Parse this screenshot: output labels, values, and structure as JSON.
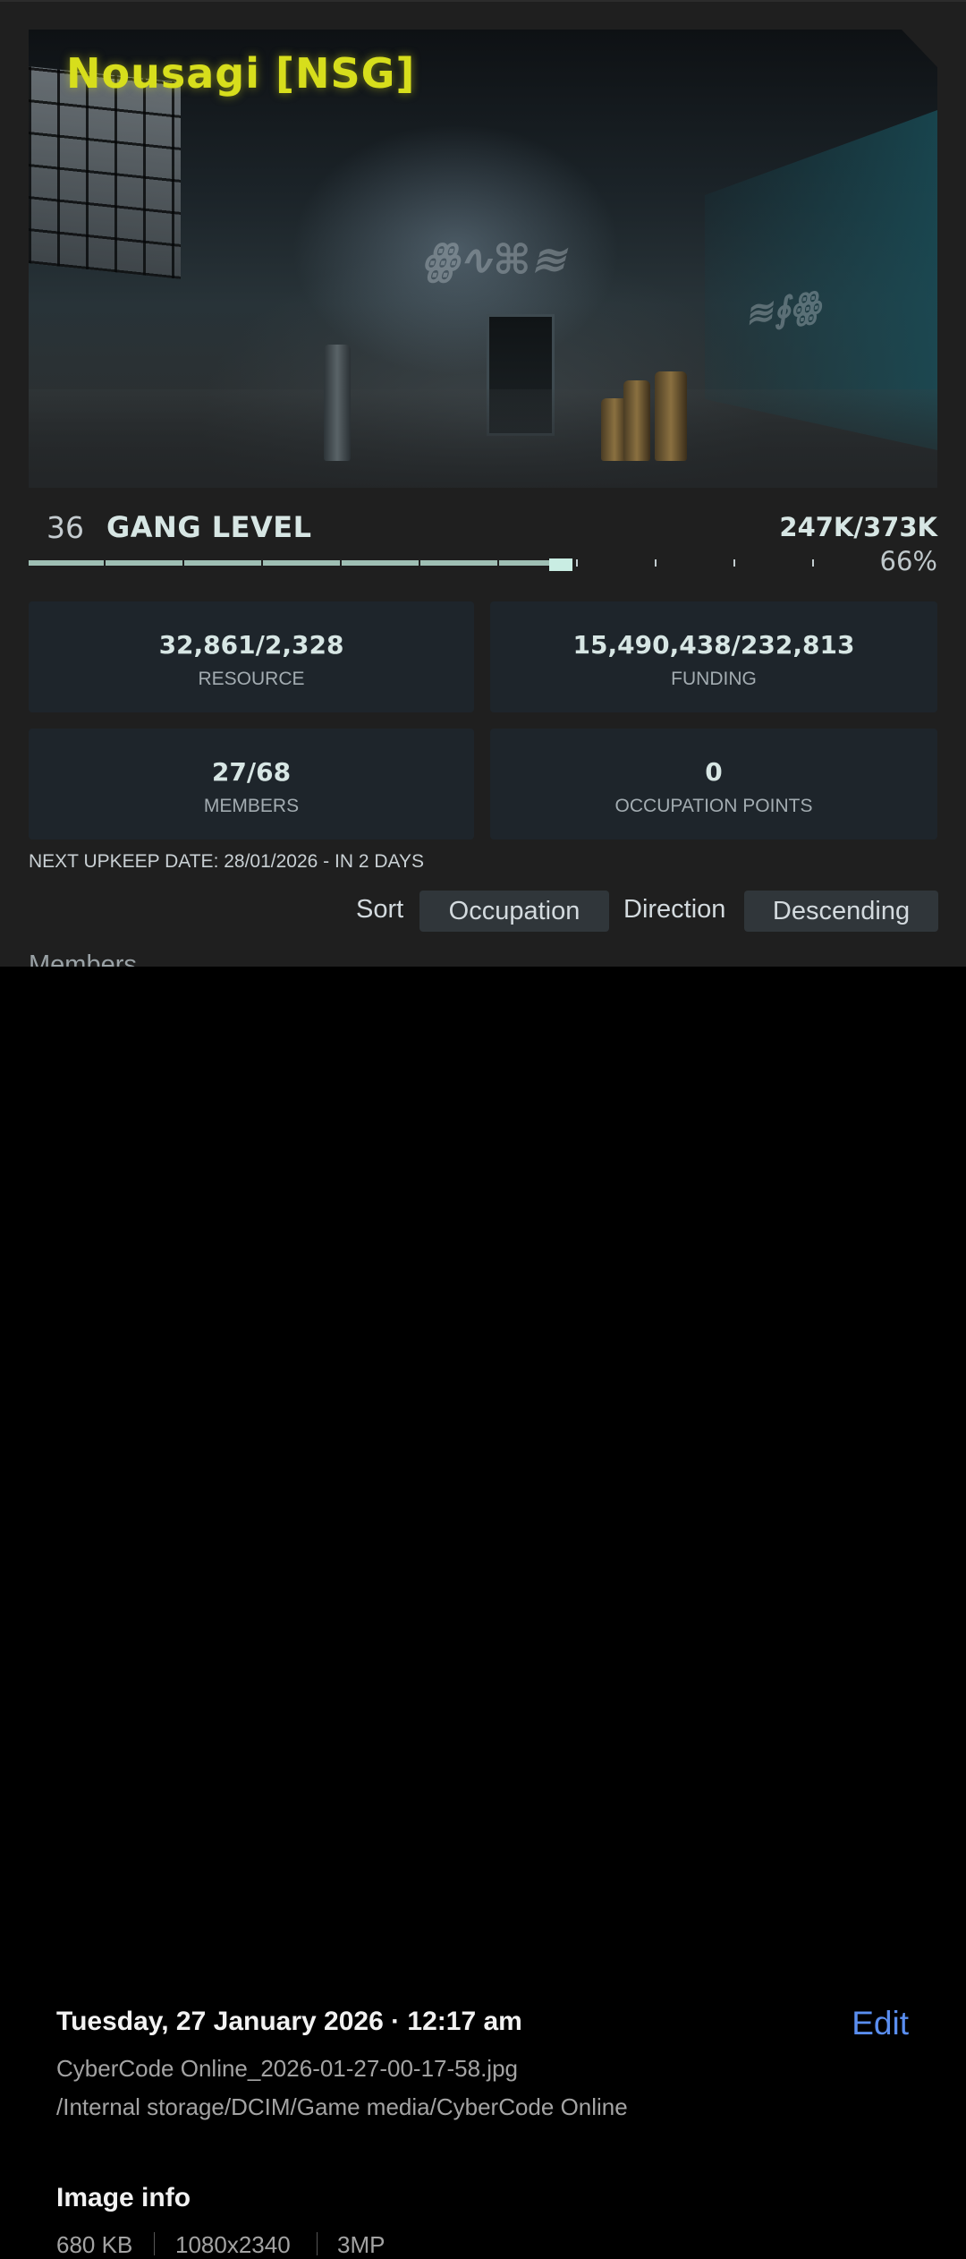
{
  "game": {
    "gang_name": "Nousagi [NSG]",
    "level": {
      "number": "36",
      "label": "GANG LEVEL",
      "xp": "247K/373K",
      "percent_text": "66%",
      "progress_fraction": 0.66
    },
    "stats": [
      {
        "value": "32,861/2,328",
        "label": "RESOURCE"
      },
      {
        "value": "15,490,438/232,813",
        "label": "FUNDING"
      },
      {
        "value": "27/68",
        "label": "MEMBERS"
      },
      {
        "value": "0",
        "label": "OCCUPATION POINTS"
      }
    ],
    "upkeep": "NEXT UPKEEP DATE: 28/01/2026 - IN 2 DAYS",
    "controls": {
      "sort_label": "Sort",
      "sort_value": "Occupation",
      "direction_label": "Direction",
      "direction_value": "Descending"
    },
    "members_heading": "Members"
  },
  "details": {
    "datetime": "Tuesday, 27 January 2026 · 12:17 am",
    "edit_label": "Edit",
    "filename": "CyberCode Online_2026-01-27-00-17-58.jpg",
    "path": "/Internal storage/DCIM/Game media/CyberCode Online",
    "image_info_heading": "Image info",
    "size": "680 KB",
    "resolution": "1080x2340",
    "megapixels": "3MP"
  },
  "colors": {
    "title_yellow": "#d7de1c",
    "edit_blue": "#5a8ef0",
    "progress": "#9fbfb4"
  }
}
